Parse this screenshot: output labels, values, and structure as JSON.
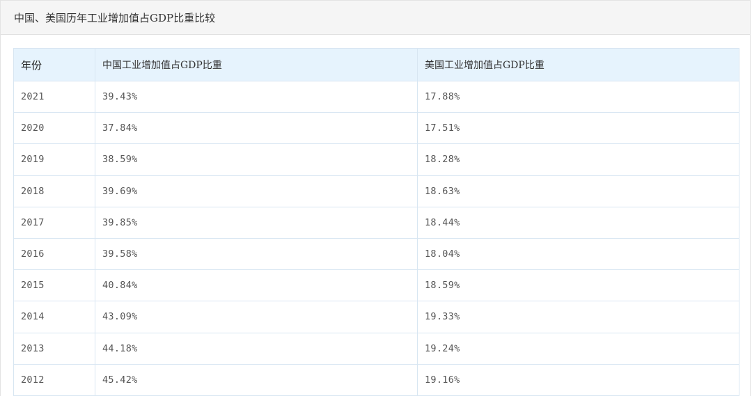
{
  "panel": {
    "title": "中国、美国历年工业增加值占GDP比重比较"
  },
  "table": {
    "headers": [
      "年份",
      "中国工业增加值占GDP比重",
      "美国工业增加值占GDP比重"
    ],
    "rows": [
      [
        "2021",
        "39.43%",
        "17.88%"
      ],
      [
        "2020",
        "37.84%",
        "17.51%"
      ],
      [
        "2019",
        "38.59%",
        "18.28%"
      ],
      [
        "2018",
        "39.69%",
        "18.63%"
      ],
      [
        "2017",
        "39.85%",
        "18.44%"
      ],
      [
        "2016",
        "39.58%",
        "18.04%"
      ],
      [
        "2015",
        "40.84%",
        "18.59%"
      ],
      [
        "2014",
        "43.09%",
        "19.33%"
      ],
      [
        "2013",
        "44.18%",
        "19.24%"
      ],
      [
        "2012",
        "45.42%",
        "19.16%"
      ]
    ]
  },
  "colors": {
    "header_background": "#f5f5f5",
    "table_header_background": "#e6f3fd",
    "table_border": "#d8e6f2"
  }
}
